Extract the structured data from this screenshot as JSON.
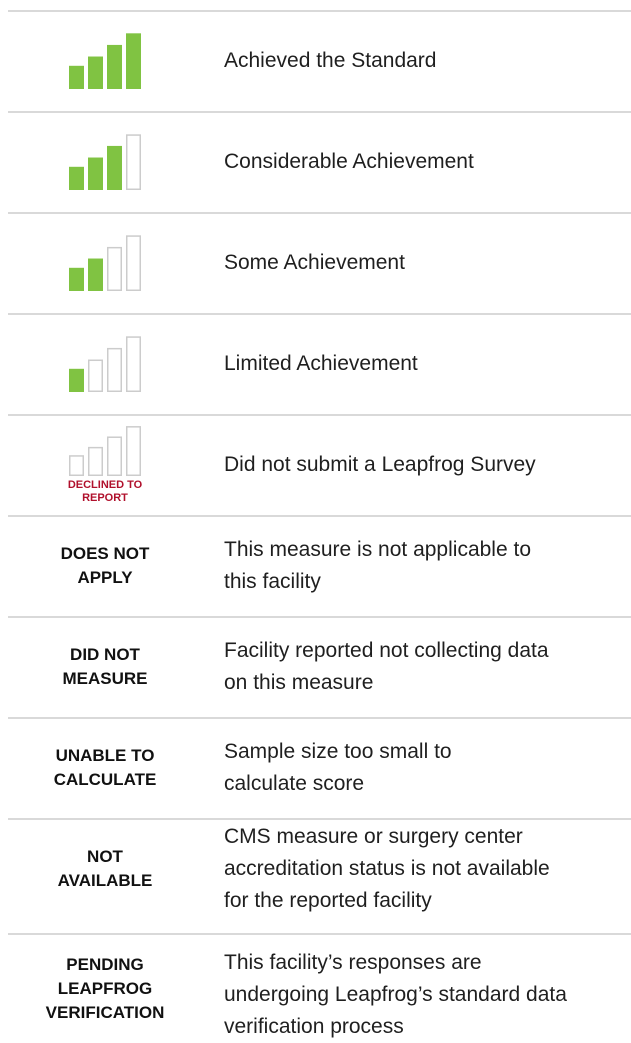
{
  "colors": {
    "filled": "#80c342",
    "empty_stroke": "#cccccc",
    "declined_text": "#b0102c",
    "divider": "#d9d9d9"
  },
  "rows": [
    {
      "icon": "signal-bars-4-icon",
      "filled_bars": 4,
      "description": "Achieved the Standard"
    },
    {
      "icon": "signal-bars-3-icon",
      "filled_bars": 3,
      "description": "Considerable Achievement"
    },
    {
      "icon": "signal-bars-2-icon",
      "filled_bars": 2,
      "description": "Some Achievement"
    },
    {
      "icon": "signal-bars-1-icon",
      "filled_bars": 1,
      "description": "Limited Achievement"
    },
    {
      "icon": "signal-bars-0-icon",
      "filled_bars": 0,
      "label_lines": [
        "DECLINED TO",
        "REPORT"
      ],
      "description": "Did not submit a Leapfrog Survey"
    },
    {
      "code_lines": [
        "DOES NOT",
        "APPLY"
      ],
      "description_lines": [
        "This measure is not applicable to",
        "this facility"
      ]
    },
    {
      "code_lines": [
        "DID NOT",
        "MEASURE"
      ],
      "description_lines": [
        "Facility reported not collecting data",
        "on this measure"
      ]
    },
    {
      "code_lines": [
        "UNABLE TO",
        "CALCULATE"
      ],
      "description_lines": [
        "Sample size too small to",
        "calculate score"
      ]
    },
    {
      "code_lines": [
        "NOT",
        "AVAILABLE"
      ],
      "description_lines": [
        "CMS measure or surgery center",
        "accreditation status is not available",
        "for the reported facility"
      ]
    },
    {
      "code_lines": [
        "PENDING",
        "LEAPFROG",
        "VERIFICATION"
      ],
      "description_lines": [
        "This facility’s responses are",
        "undergoing Leapfrog’s standard data",
        "verification process"
      ]
    }
  ]
}
